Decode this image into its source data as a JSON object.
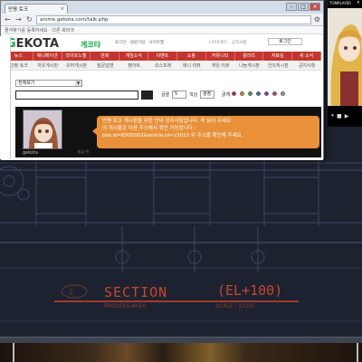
{
  "browser": {
    "tab_title": "만평 토크",
    "address": "anime.gekota.com/talk.php",
    "bookmarks_text": "즐겨찾기를 등록하세요 · 다른 북마크",
    "window_buttons": [
      "–",
      "□",
      "×"
    ]
  },
  "site": {
    "logo_prefix": "G",
    "logo_rest": "EKOTA",
    "logo_sub": "게코타",
    "top_links": "로그인 · 회원가입 · 사이트맵",
    "top_links_right": "나이트로드 · 공지사항",
    "login_label": "로그인",
    "main_nav": [
      "뉴스",
      "애니메이션",
      "라이트노벨",
      "만화",
      "게임소식",
      "이벤트",
      "쇼핑",
      "커뮤니티",
      "갤러리",
      "자료실",
      "새 소식"
    ],
    "sub_nav": [
      "만평 토크",
      "자유게시판",
      "유머게시판",
      "질문답변",
      "팬아트",
      "코스프레",
      "애니 리뷰",
      "게임 리뷰",
      "나눔게시판",
      "건의게시판",
      "공지사항"
    ],
    "filter_value": "전체보기"
  },
  "composer": {
    "font_label": "글꼴",
    "font_value": "5",
    "color_label": "색상",
    "color_value": "검정",
    "bold_label": "굵게",
    "swatch_colors": [
      "#cc2222",
      "#e08a1a",
      "#33aa33",
      "#2266cc",
      "#8833aa",
      "#cc3399",
      "#999999"
    ]
  },
  "chat": {
    "avatar_name": "gekota",
    "lines": [
      "만평 토크 게시판을 위한 안내 공지사항입니다. 꼭 읽어 주세요.",
      "이 게시물은 다음 주소에서 확인 가능합니다 :",
      "bbs.id=E000002&article.id=23015  위 주소를 확인해 주세요."
    ],
    "meta": "방금 전"
  },
  "player": {
    "title": "TOMPLAYER",
    "close": "×",
    "controls": [
      "⏸",
      "■",
      "▶"
    ]
  },
  "cad": {
    "title": "SECTION",
    "elevation": "(EL+100)",
    "subtitle": "PROCESS AREA",
    "scale": "SCALE : 1/100",
    "number": "2"
  }
}
